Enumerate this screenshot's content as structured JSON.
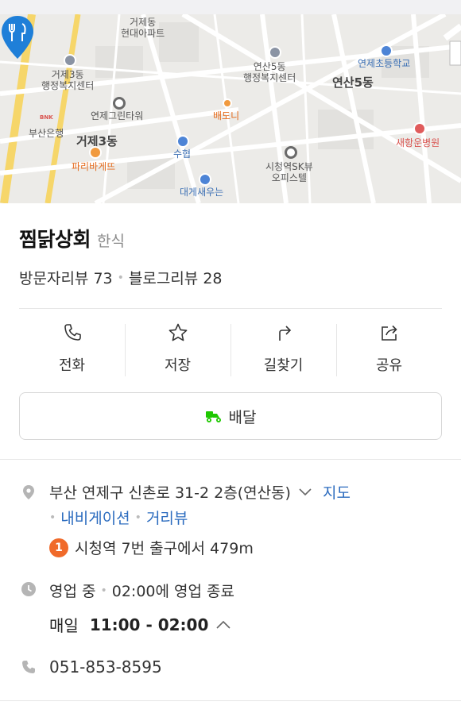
{
  "map": {
    "labels": [
      {
        "id": "geoje-dong-top",
        "text": "거제동\n현대아파트"
      },
      {
        "id": "yeonsan5-center",
        "text": "연산5동\n행정복지센터"
      },
      {
        "id": "yeonje-school",
        "text": "연제초등학교"
      },
      {
        "id": "yeonsan5",
        "text": "연산5동"
      },
      {
        "id": "geoje3-center",
        "text": "거제3동\n행정복지센터"
      },
      {
        "id": "yeonje-green",
        "text": "연제그린타워"
      },
      {
        "id": "busan-bank",
        "text": "부산은행"
      },
      {
        "id": "geoje3",
        "text": "거제3동"
      },
      {
        "id": "paris",
        "text": "파리바게뜨"
      },
      {
        "id": "suhyup",
        "text": "수협"
      },
      {
        "id": "sk-view",
        "text": "시청역SK뷰\n오피스텔"
      },
      {
        "id": "saehyang",
        "text": "새항운병원"
      },
      {
        "id": "daege",
        "text": "대게새우는"
      },
      {
        "id": "pin-name",
        "text": "배도니"
      },
      {
        "id": "bnk",
        "text": "BNK"
      }
    ]
  },
  "place": {
    "name": "찜닭상회",
    "category": "한식",
    "visitor_reviews": "방문자리뷰 73",
    "blog_reviews": "블로그리뷰 28"
  },
  "actions": [
    {
      "label": "전화",
      "icon": "phone-icon"
    },
    {
      "label": "저장",
      "icon": "star-icon"
    },
    {
      "label": "길찾기",
      "icon": "directions-icon"
    },
    {
      "label": "공유",
      "icon": "share-icon"
    }
  ],
  "delivery": {
    "label": "배달",
    "icon": "delivery-scooter-icon",
    "color": "#1ec800"
  },
  "address": {
    "text": "부산 연제구 신촌로 31-2 2층(연산동)",
    "map_link": "지도",
    "nav_link": "내비게이션",
    "street_link": "거리뷰"
  },
  "subway": {
    "line": "1",
    "line_color": "#f06a2a",
    "text": "시청역 7번 출구에서 479m"
  },
  "hours": {
    "status": "영업 중",
    "close_info": "02:00에 영업 종료",
    "day": "매일",
    "time": "11:00 - 02:00"
  },
  "phone": {
    "number": "051-853-8595"
  },
  "colors": {
    "link": "#2c6cbf",
    "pin": "#1f7fd8"
  }
}
